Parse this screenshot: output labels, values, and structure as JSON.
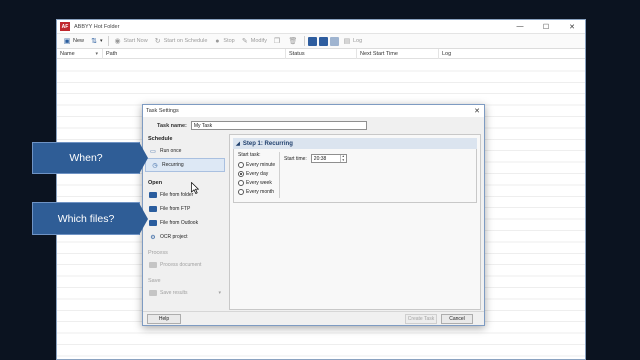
{
  "window": {
    "title": "ABBYY Hot Folder",
    "minimize": "—",
    "maximize": "☐",
    "close": "✕"
  },
  "toolbar": {
    "new_label": "New",
    "start_now": "Start Now",
    "start_on_schedule": "Start on Schedule",
    "stop": "Stop",
    "modify": "Modify",
    "log": "Log"
  },
  "grid": {
    "columns": [
      "Name",
      "Path",
      "Status",
      "Next Start Time",
      "Log"
    ]
  },
  "dialog": {
    "title": "Task Settings",
    "task_name_label": "Task name:",
    "task_name_value": "My Task",
    "schedule_header": "Schedule",
    "run_once": "Run once",
    "recurring": "Recurring",
    "open_header": "Open",
    "file_from_folder": "File from folder",
    "file_from_ftp": "File from FTP",
    "file_from_outlook": "File from Outlook",
    "ocr_project": "OCR project",
    "process_header": "Process",
    "process_document": "Process document",
    "save_header": "Save",
    "save_results": "Save results",
    "step_title": "Step 1: Recurring",
    "start_task_label": "Start task:",
    "every_minute": "Every minute",
    "every_day": "Every day",
    "every_week": "Every week",
    "every_month": "Every month",
    "selected_frequency": "Every day",
    "start_time_label": "Start time:",
    "start_time_value": "20:38",
    "help": "Help",
    "create_task": "Create Task",
    "cancel": "Cancel"
  },
  "callouts": {
    "when": "When?",
    "which_files": "Which files?"
  },
  "colors": {
    "background": "#0b1320",
    "callout": "#2f5d96",
    "accent": "#2a5d9e",
    "app_icon": "#c0262d"
  }
}
